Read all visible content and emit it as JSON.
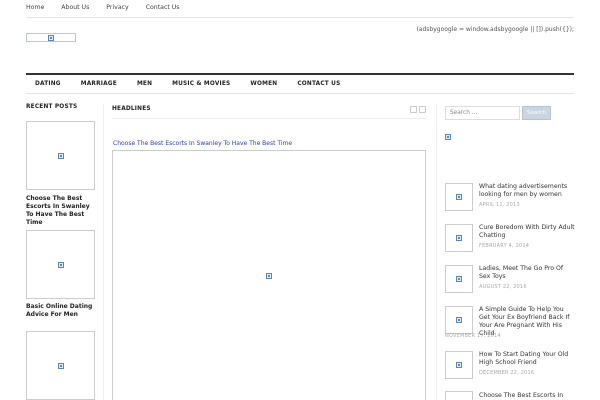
{
  "top_nav": [
    "Home",
    "About Us",
    "Privacy",
    "Contact Us"
  ],
  "adsense_text": "(adsbygoogle = window.adsbygoogle || []).push({});",
  "main_nav": [
    "DATING",
    "MARRIAGE",
    "MEN",
    "MUSIC & MOVIES",
    "WOMEN",
    "CONTACT US"
  ],
  "recent_posts": {
    "title": "RECENT POSTS",
    "items": [
      {
        "title": "Choose The Best Escorts In Swanley To Have The Best Time"
      },
      {
        "title": "Basic Online Dating Advice For Men"
      },
      {
        "title": ""
      }
    ]
  },
  "headlines": {
    "title": "HEADLINES",
    "post_link": "Choose The Best Escorts In Swanley To Have The Best Time"
  },
  "search": {
    "placeholder": "Search ...",
    "button_label": "Search"
  },
  "sidebar_posts": [
    {
      "title": "What dating advertisements looking for men by women",
      "date": "APRIL 11, 2013"
    },
    {
      "title": "Cure Boredom With Dirty Adult Chatting",
      "date": "FEBRUARY 4, 2014"
    },
    {
      "title": "Ladies, Meet The Go Pro Of Sex Toys",
      "date": "AUGUST 22, 2016"
    },
    {
      "title": "A Simple Guide To Help You Get Your Ex Boyfriend Back If Your Are Pregnant With His Child",
      "date": "NOVEMBER 17, 2014"
    },
    {
      "title": "How To Start Dating Your Old High School Friend",
      "date": "DECEMBER 22, 2016"
    },
    {
      "title": "Choose The Best Escorts In",
      "date": ""
    }
  ],
  "colors": {
    "nav_border": "#333333",
    "link_blue": "#2a3fb0",
    "search_button": "#c9d5e0"
  },
  "icons": {
    "broken_image": "broken-image-icon"
  }
}
